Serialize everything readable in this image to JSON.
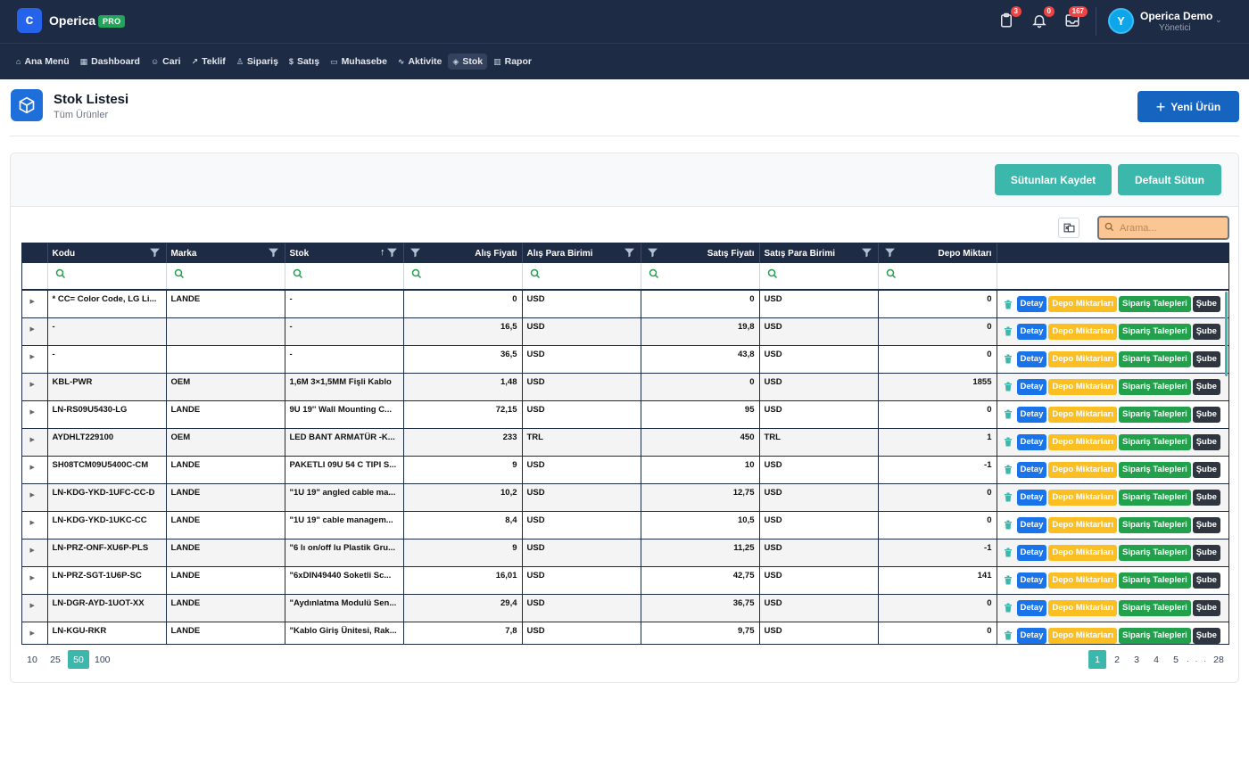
{
  "app": {
    "name": "Operica",
    "badge": "PRO",
    "logo_letter": "c"
  },
  "header": {
    "icons": [
      {
        "name": "clipboard-icon",
        "count": "3"
      },
      {
        "name": "bell-icon",
        "count": "0"
      },
      {
        "name": "inbox-icon",
        "count": "167"
      }
    ],
    "user": {
      "initial": "Y",
      "name": "Operica Demo",
      "role": "Yönetici"
    }
  },
  "nav": [
    {
      "label": "Ana Menü",
      "icon": "home-icon"
    },
    {
      "label": "Dashboard",
      "icon": "grid-icon"
    },
    {
      "label": "Cari",
      "icon": "users-icon"
    },
    {
      "label": "Teklif",
      "icon": "trend-icon"
    },
    {
      "label": "Sipariş",
      "icon": "user-icon"
    },
    {
      "label": "Satış",
      "icon": "dollar-icon"
    },
    {
      "label": "Muhasebe",
      "icon": "card-icon"
    },
    {
      "label": "Aktivite",
      "icon": "activity-icon"
    },
    {
      "label": "Stok",
      "icon": "box-icon",
      "active": true
    },
    {
      "label": "Rapor",
      "icon": "bar-chart-icon"
    }
  ],
  "page": {
    "title": "Stok Listesi",
    "subtitle": "Tüm Ürünler",
    "new_button": "Yeni Ürün"
  },
  "toolbar": {
    "save_columns": "Sütunları Kaydet",
    "default_columns": "Default Sütun",
    "search_placeholder": "Arama..."
  },
  "columns": [
    "Kodu",
    "Marka",
    "Stok",
    "Alış Fiyatı",
    "Alış Para Birimi",
    "Satış Fiyatı",
    "Satış Para Birimi",
    "Depo Miktarı"
  ],
  "row_actions": {
    "detail": "Detay",
    "stock": "Depo Miktarları",
    "orders": "Sipariş Talepleri",
    "branch": "Şube"
  },
  "rows": [
    [
      "* CC= Color Code, LG Li...",
      "LANDE",
      "-",
      "0",
      "USD",
      "0",
      "USD",
      "0"
    ],
    [
      "-",
      "",
      "-",
      "16,5",
      "USD",
      "19,8",
      "USD",
      "0"
    ],
    [
      "-",
      "",
      "-",
      "36,5",
      "USD",
      "43,8",
      "USD",
      "0"
    ],
    [
      "KBL-PWR",
      "OEM",
      "1,6M 3×1,5MM Fişli Kablo",
      "1,48",
      "USD",
      "0",
      "USD",
      "1855"
    ],
    [
      "LN-RS09U5430-LG",
      "LANDE",
      "9U 19'' Wall Mounting C...",
      "72,15",
      "USD",
      "95",
      "USD",
      "0"
    ],
    [
      "AYDHLT229100",
      "OEM",
      "LED BANT ARMATÜR -K...",
      "233",
      "TRL",
      "450",
      "TRL",
      "1"
    ],
    [
      "SH08TCM09U5400C-CM",
      "LANDE",
      "PAKETLI 09U 54 C TIPI S...",
      "9",
      "USD",
      "10",
      "USD",
      "-1"
    ],
    [
      "LN-KDG-YKD-1UFC-CC-D",
      "LANDE",
      "\"1U 19\" angled cable ma...",
      "10,2",
      "USD",
      "12,75",
      "USD",
      "0"
    ],
    [
      "LN-KDG-YKD-1UKC-CC",
      "LANDE",
      "\"1U 19\" cable managem...",
      "8,4",
      "USD",
      "10,5",
      "USD",
      "0"
    ],
    [
      "LN-PRZ-ONF-XU6P-PLS",
      "LANDE",
      "\"6 lı on/off lu Plastik Gru...",
      "9",
      "USD",
      "11,25",
      "USD",
      "-1"
    ],
    [
      "LN-PRZ-SGT-1U6P-SC",
      "LANDE",
      "\"6xDIN49440 Soketli Sc...",
      "16,01",
      "USD",
      "42,75",
      "USD",
      "141"
    ],
    [
      "LN-DGR-AYD-1UOT-XX",
      "LANDE",
      "\"Aydınlatma Modulü Sen...",
      "29,4",
      "USD",
      "36,75",
      "USD",
      "0"
    ],
    [
      "LN-KGU-RKR",
      "LANDE",
      "\"Kablo Giriş Ünitesi, Rak...",
      "7,8",
      "USD",
      "9,75",
      "USD",
      "0"
    ]
  ],
  "page_sizes": [
    "10",
    "25",
    "50",
    "100"
  ],
  "selected_page_size": "50",
  "pages": [
    "1",
    "2",
    "3",
    "4",
    "5"
  ],
  "current_page": "1",
  "last_page": "28",
  "ellipsis": ". . .",
  "colors": {
    "accent_teal": "#3cb7ac",
    "header_navy": "#1e2b45",
    "primary_blue": "#1565c0"
  }
}
